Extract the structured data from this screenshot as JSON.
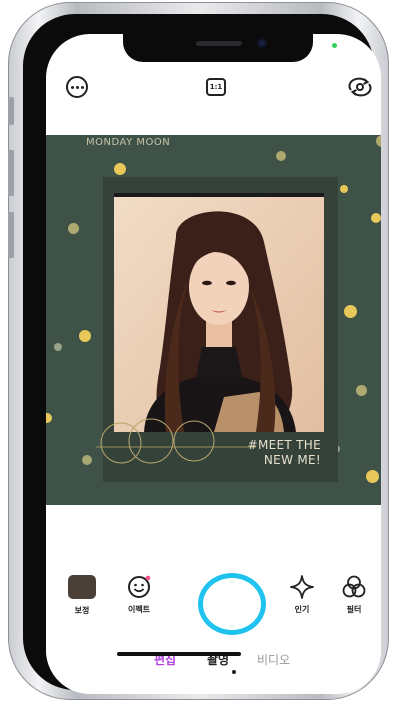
{
  "topbar": {
    "menu_icon": "more-horizontal-icon",
    "ratio_label": "1:1",
    "flip_icon": "camera-flip-icon"
  },
  "overlay": {
    "brand": "MONDAY MOON",
    "tagline_line1": "#MEET THE",
    "tagline_line2": "NEW ME!"
  },
  "tools": {
    "beauty_label": "보정",
    "effect_label": "이펙트",
    "popular_label": "인기",
    "filter_label": "필터"
  },
  "modes": [
    {
      "label": "편집",
      "color": "#b340e0"
    },
    {
      "label": "촬영",
      "color": "#222222",
      "selected": true
    },
    {
      "label": "비디오",
      "color": "#999999"
    }
  ],
  "colors": {
    "shutter_ring": "#1fc3ef",
    "background": "#3f5248",
    "polka_dot": "#e8c85a"
  }
}
